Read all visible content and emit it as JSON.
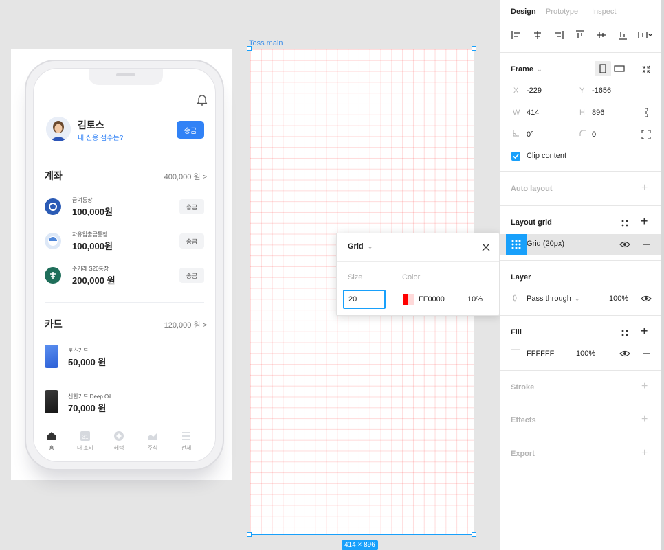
{
  "phone": {
    "user_name": "김토스",
    "user_sub": "내 신용 점수는?",
    "send_label": "송금",
    "accounts_title": "계좌",
    "accounts_total": "400,000 원 >",
    "accounts": [
      {
        "name": "급여통장",
        "amount": "100,000원",
        "btn": "송금",
        "color": "#2b5bb5"
      },
      {
        "name": "자유입출금통장",
        "amount": "100,000원",
        "btn": "송금",
        "color": "#4f86d9"
      },
      {
        "name": "주거래 S20통장",
        "amount": "200,000 원",
        "btn": "송금",
        "color": "#1f6e5a"
      }
    ],
    "cards_title": "카드",
    "cards_total": "120,000 원 >",
    "cards": [
      {
        "name": "토스카드",
        "amount": "50,000 원",
        "color": "#3f72e8"
      },
      {
        "name": "신한카드 Deep Oil",
        "amount": "70,000 원",
        "color": "#2b2b2b"
      }
    ],
    "tabs": [
      {
        "label": "홈",
        "icon": "home-icon"
      },
      {
        "label": "내 소비",
        "icon": "calendar-icon",
        "badge": "31"
      },
      {
        "label": "혜택",
        "icon": "plus-circle-icon"
      },
      {
        "label": "주식",
        "icon": "chart-icon"
      },
      {
        "label": "전체",
        "icon": "menu-icon"
      }
    ]
  },
  "canvas": {
    "frame_label": "Toss main",
    "size_badge": "414 × 896"
  },
  "grid_popover": {
    "title": "Grid",
    "size_label": "Size",
    "color_label": "Color",
    "size_value": "20",
    "color_hex": "FF0000",
    "opacity": "10%"
  },
  "panel": {
    "tabs": [
      "Design",
      "Prototype",
      "Inspect"
    ],
    "frame": {
      "title": "Frame",
      "x_label": "X",
      "x_value": "-229",
      "y_label": "Y",
      "y_value": "-1656",
      "w_label": "W",
      "w_value": "414",
      "h_label": "H",
      "h_value": "896",
      "rotation": "0°",
      "radius": "0",
      "clip_label": "Clip content",
      "clip_checked": true
    },
    "auto_layout": "Auto layout",
    "layout_grid": {
      "title": "Layout grid",
      "item": "Grid (20px)"
    },
    "layer": {
      "title": "Layer",
      "mode": "Pass through",
      "opacity": "100%"
    },
    "fill": {
      "title": "Fill",
      "hex": "FFFFFF",
      "opacity": "100%"
    },
    "stroke": "Stroke",
    "effects": "Effects",
    "export": "Export"
  },
  "colors": {
    "accent": "#18a0fb",
    "toss_blue": "#3182f6",
    "grid_red": "#ff0000"
  }
}
